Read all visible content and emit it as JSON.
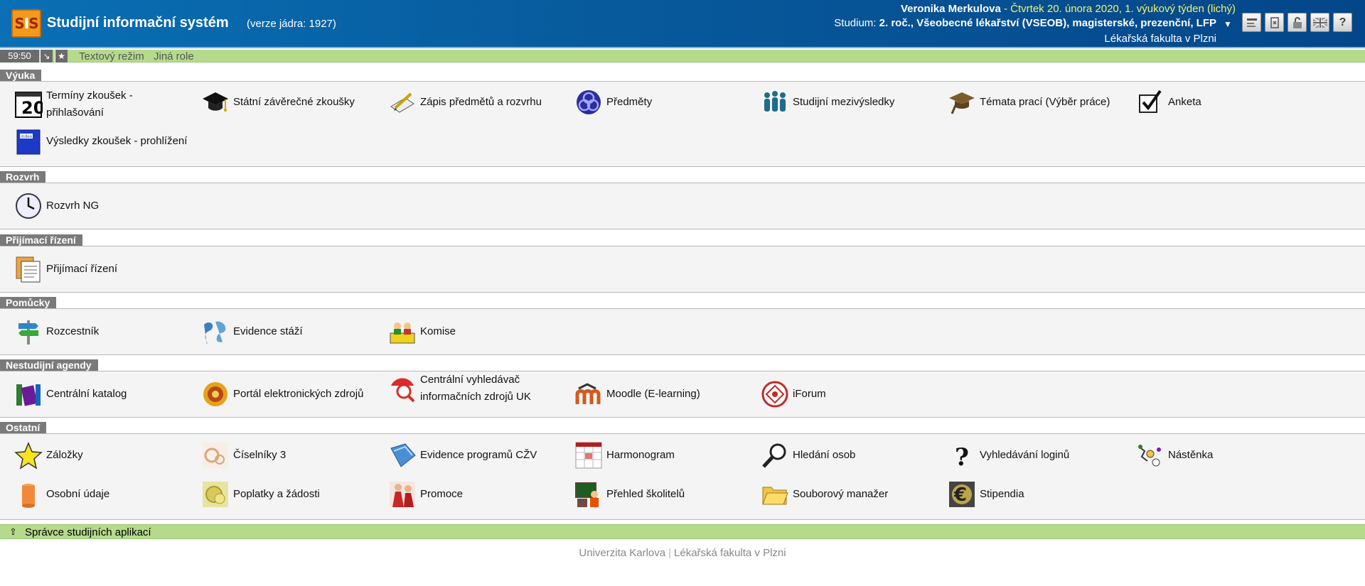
{
  "header": {
    "logo_text_left": "S",
    "logo_text_mid": "I",
    "logo_text_right": "S",
    "title": "Studijní informační systém",
    "version": "(verze jádra: 1927)",
    "user_name": "Veronika Merkulova",
    "user_date": " - Čtvrtek 20. února 2020, 1. výukový týden (lichý)",
    "study_label": "Studium:",
    "study_value": "2. roč., Všeobecné lékařství (VSEOB), magisterské, prezenční, LFP",
    "faculty": "Lékařská fakulta v Plzni",
    "tools": [
      "text-mode-icon",
      "role-icon",
      "logout-lock-icon",
      "english-flag-icon",
      "help-icon"
    ]
  },
  "toolbar": {
    "timer": "59:50",
    "text_mode": "Textový režim",
    "other_role": "Jiná role"
  },
  "sections": [
    {
      "title": "Výuka",
      "items": [
        {
          "label_1": "Termíny zkoušek -",
          "label_2": "přihlašování",
          "icon": "calendar-exam-icon"
        },
        {
          "label_1": "Státní závěrečné zkoušky",
          "icon": "graduation-cap-icon"
        },
        {
          "label_1": "Zápis předmětů a rozvrhu",
          "icon": "pen-notebook-icon"
        },
        {
          "label_1": "Předměty",
          "icon": "celtic-knot-icon"
        },
        {
          "label_1": "Studijní mezivýsledky",
          "icon": "people-group-icon"
        },
        {
          "label_1": "Témata prací (Výběr práce)",
          "icon": "mortarboard-icon"
        },
        {
          "label_1": "Anketa",
          "icon": "checkbox-icon"
        },
        {
          "label_1": "Výsledky zkoušek - prohlížení",
          "icon": "index-book-icon"
        }
      ]
    },
    {
      "title": "Rozvrh",
      "items": [
        {
          "label_1": "Rozvrh NG",
          "icon": "clock-icon"
        }
      ]
    },
    {
      "title": "Přijímací řízení",
      "items": [
        {
          "label_1": "Přijímací řízení",
          "icon": "documents-icon"
        }
      ]
    },
    {
      "title": "Pomůcky",
      "items": [
        {
          "label_1": "Rozcestník",
          "icon": "signpost-icon"
        },
        {
          "label_1": "Evidence stáží",
          "icon": "world-map-icon"
        },
        {
          "label_1": "Komise",
          "icon": "committee-icon"
        }
      ]
    },
    {
      "title": "Nestudijní agendy",
      "items": [
        {
          "label_1": "Centrální katalog",
          "icon": "books-icon"
        },
        {
          "label_1": "Portál elektronických zdrojů",
          "icon": "portal-icon"
        },
        {
          "label_1": "Centrální vyhledávač",
          "label_2": "informačních zdrojů UK",
          "icon": "search-lens-icon"
        },
        {
          "label_1": "Moodle (E-learning)",
          "icon": "moodle-icon"
        },
        {
          "label_1": "iForum",
          "icon": "iforum-icon"
        }
      ]
    },
    {
      "title": "Ostatní",
      "items": [
        {
          "label_1": "Záložky",
          "icon": "star-icon"
        },
        {
          "label_1": "Číselníky 3",
          "icon": "codebook-icon"
        },
        {
          "label_1": "Evidence programů CŽV",
          "icon": "blue-folder-icon"
        },
        {
          "label_1": "Harmonogram",
          "icon": "calendar-icon"
        },
        {
          "label_1": "Hledání osob",
          "icon": "magnifier-icon"
        },
        {
          "label_1": "Vyhledávání loginů",
          "icon": "question-mark-icon"
        },
        {
          "label_1": "Nástěnka",
          "icon": "noticeboard-icon"
        },
        {
          "label_1": "Osobní údaje",
          "icon": "personal-data-icon"
        },
        {
          "label_1": "Poplatky a žádosti",
          "icon": "fees-icon"
        },
        {
          "label_1": "Promoce",
          "icon": "graduation-ceremony-icon"
        },
        {
          "label_1": "Přehled školitelů",
          "icon": "teacher-icon"
        },
        {
          "label_1": "Souborový manažer",
          "icon": "file-manager-icon"
        },
        {
          "label_1": "Stipendia",
          "icon": "euro-icon"
        }
      ]
    }
  ],
  "admin": {
    "label": "Správce studijních aplikací"
  },
  "footer": {
    "university": "Univerzita Karlova",
    "separator": "|",
    "faculty": "Lékařská fakulta v Plzni"
  }
}
